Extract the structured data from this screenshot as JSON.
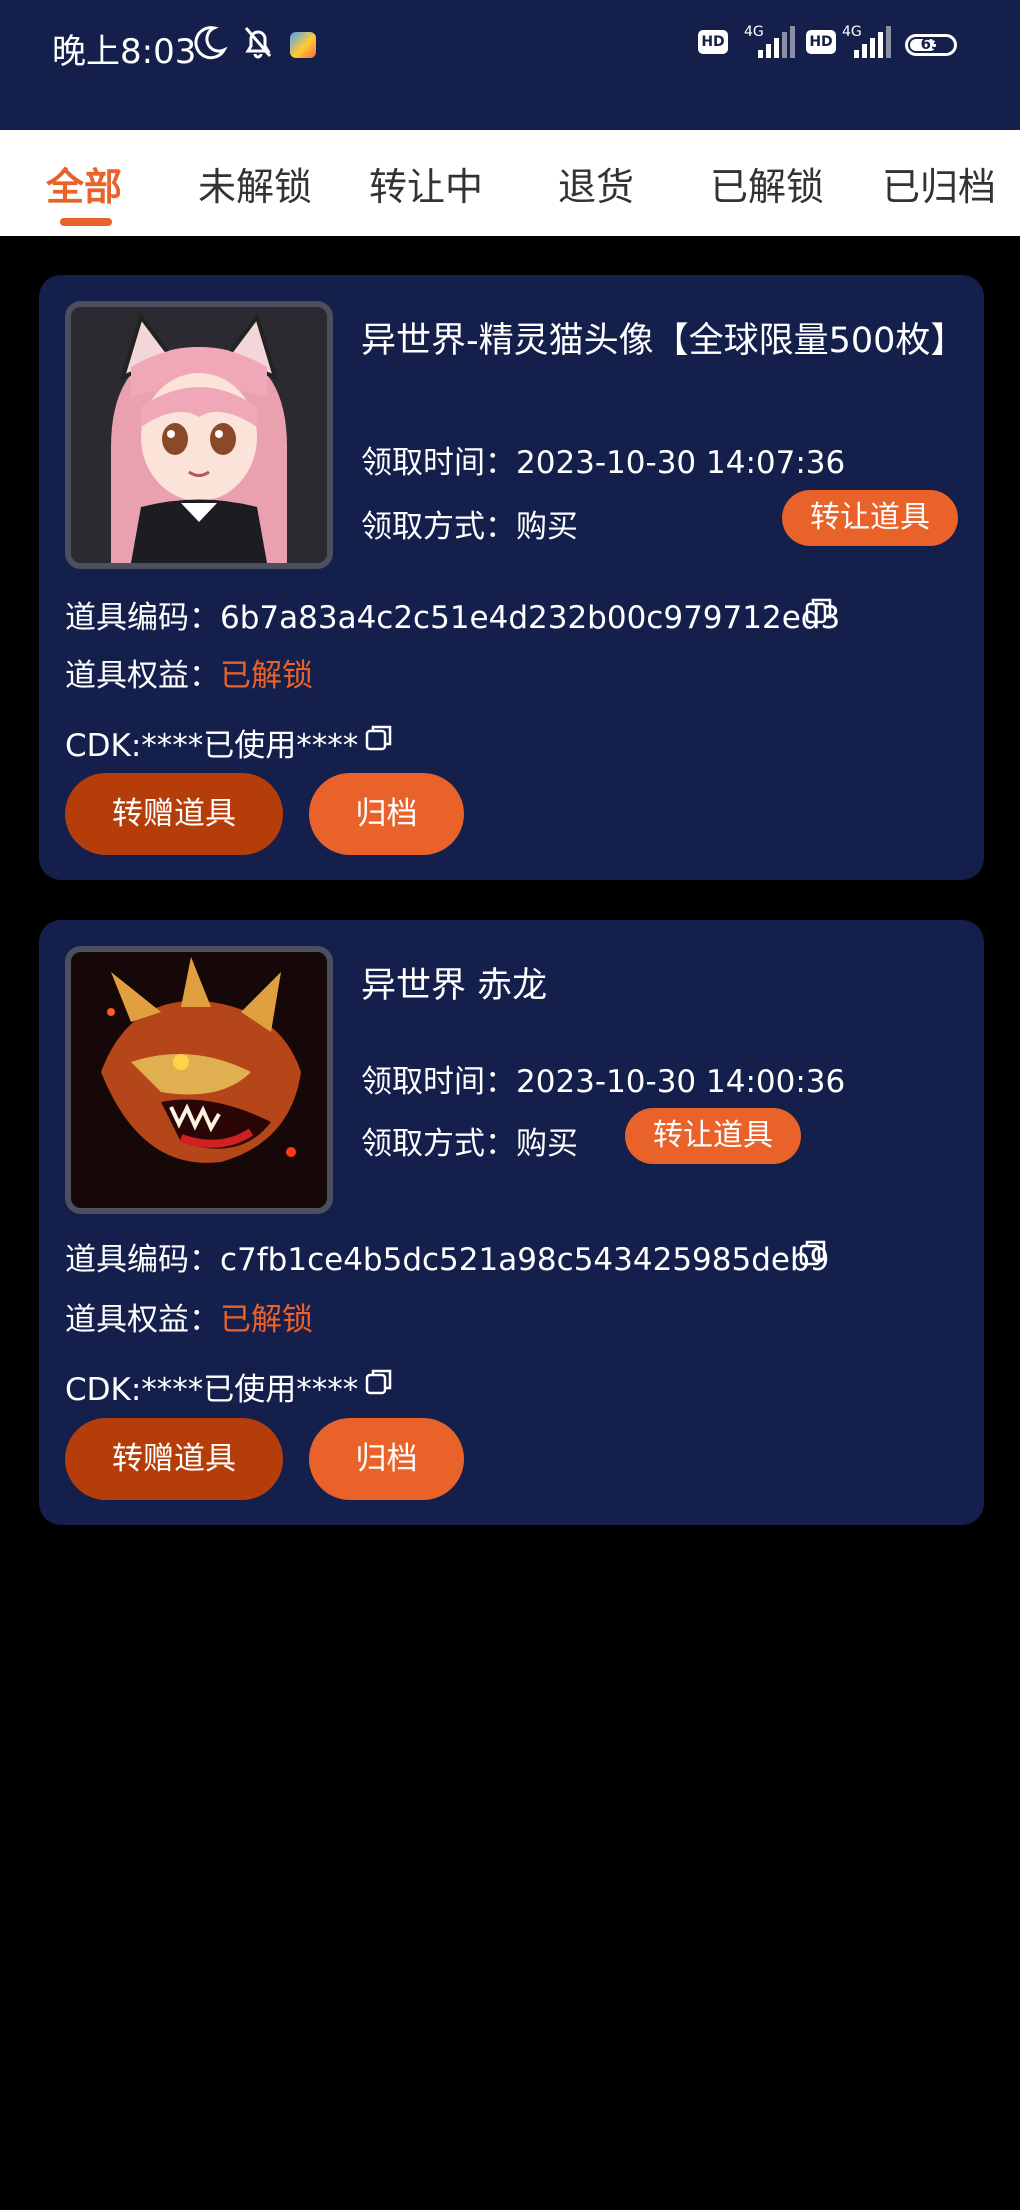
{
  "status_bar": {
    "time": "晚上8:03",
    "network_1": "4G",
    "network_2": "4G",
    "hd_1": "HD",
    "hd_2": "HD",
    "battery": "63",
    "battery_level_percent": 63
  },
  "tabs": [
    {
      "label": "全部",
      "active": true
    },
    {
      "label": "未解锁",
      "active": false
    },
    {
      "label": "转让中",
      "active": false
    },
    {
      "label": "退货",
      "active": false
    },
    {
      "label": "已解锁",
      "active": false
    },
    {
      "label": "已归档",
      "active": false
    }
  ],
  "items": [
    {
      "title": "异世界-精灵猫头像【全球限量500枚】",
      "time_label": "领取时间：",
      "time_value": "2023-10-30 14:07:36",
      "method_label": "领取方式：",
      "method_value": "购买",
      "transfer_label": "转让道具",
      "code_label": "道具编码：",
      "code_value": "6b7a83a4c2c51e4d232b00c979712ed3",
      "rights_label": "道具权益：",
      "rights_value": "已解锁",
      "cdk_text": "CDK:****已使用****",
      "gift_button": "转赠道具",
      "archive_button": "归档"
    },
    {
      "title": "异世界 赤龙",
      "time_label": "领取时间：",
      "time_value": "2023-10-30 14:00:36",
      "method_label": "领取方式：",
      "method_value": "购买",
      "transfer_label": "转让道具",
      "code_label": "道具编码：",
      "code_value": "c7fb1ce4b5dc521a98c543425985deb9",
      "rights_label": "道具权益：",
      "rights_value": "已解锁",
      "cdk_text": "CDK:****已使用****",
      "gift_button": "转赠道具",
      "archive_button": "归档"
    }
  ],
  "colors": {
    "header_bg": "#14204b",
    "card_bg": "#14204b",
    "accent": "#e8622a",
    "button_dark": "#b53d0a",
    "page_bg": "#000000"
  }
}
